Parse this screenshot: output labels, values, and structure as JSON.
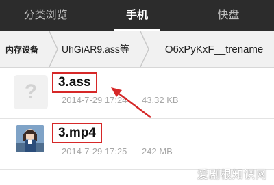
{
  "tabs": [
    {
      "label": "分类浏览",
      "active": false
    },
    {
      "label": "手机",
      "active": true
    },
    {
      "label": "快盘",
      "active": false
    }
  ],
  "breadcrumb": [
    "内存设备",
    "UhGiAR9.ass等",
    "O6xPyKxF__trename"
  ],
  "files": [
    {
      "name": "3.ass",
      "date": "2014-7-29 17:24",
      "size": "43.32 KB",
      "icon": "unknown-file-icon"
    },
    {
      "name": "3.mp4",
      "date": "2014-7-29 17:25",
      "size": "242 MB",
      "icon": "video-thumbnail"
    }
  ],
  "colors": {
    "tabbar": "#2c2c2c",
    "highlight": "#d62828",
    "meta": "#a7a7a7"
  },
  "watermark": "爱剧根知识网"
}
